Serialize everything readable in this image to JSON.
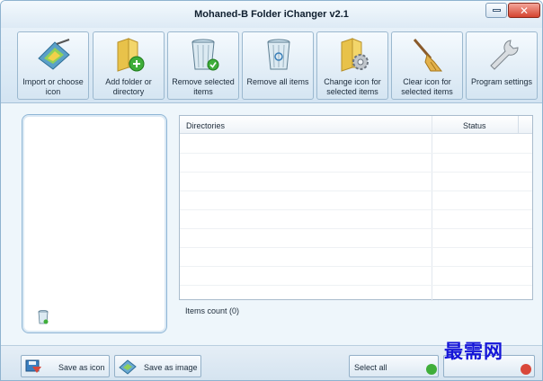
{
  "window": {
    "title": "Mohaned-B Folder iChanger v2.1"
  },
  "toolbar": {
    "buttons": [
      {
        "label": "Import or choose icon",
        "icon": "image-import-icon"
      },
      {
        "label": "Add folder or directory",
        "icon": "folder-add-icon"
      },
      {
        "label": "Remove selected items",
        "icon": "trash-check-icon"
      },
      {
        "label": "Remove all items",
        "icon": "trash-icon"
      },
      {
        "label": "Change icon for selected items",
        "icon": "folder-gear-icon"
      },
      {
        "label": "Clear icon for selected items",
        "icon": "broom-icon"
      },
      {
        "label": "Program settings",
        "icon": "wrench-icon"
      }
    ]
  },
  "list": {
    "columns": [
      "Directories",
      "Status"
    ],
    "items_count": "Items count (0)"
  },
  "bottom": {
    "save_icon": "Save as icon",
    "save_image": "Save as image",
    "select_all": "Select all"
  },
  "watermark": "最需网",
  "colors": {
    "accent": "#8fb3cf",
    "toolbar_bg": "#d9e8f4",
    "close_button": "#d5432f",
    "watermark": "#1515d8"
  }
}
